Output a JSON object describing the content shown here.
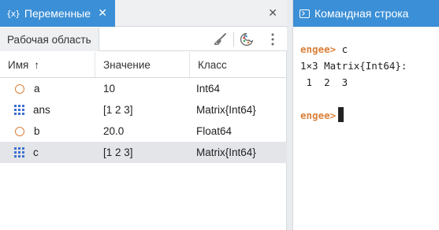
{
  "variables_panel": {
    "tab_icon": "{x}",
    "tab_title": "Переменные",
    "tab_close": "✕",
    "panel_close": "✕",
    "workspace_tab": "Рабочая область",
    "toolbar_icons": [
      "broom-icon",
      "palette-icon",
      "more-vertical-icon"
    ],
    "columns": {
      "name": "Имя",
      "sort_arrow": "↑",
      "value": "Значение",
      "class": "Класс"
    },
    "rows": [
      {
        "icon": "scalar-icon",
        "name": "a",
        "value": "10",
        "class": "Int64",
        "selected": false
      },
      {
        "icon": "matrix-icon",
        "name": "ans",
        "value": "[1 2 3]",
        "class": "Matrix{Int64}",
        "selected": false
      },
      {
        "icon": "scalar-icon",
        "name": "b",
        "value": "20.0",
        "class": "Float64",
        "selected": false
      },
      {
        "icon": "matrix-icon",
        "name": "c",
        "value": "[1 2 3]",
        "class": "Matrix{Int64}",
        "selected": true
      }
    ]
  },
  "command_panel": {
    "tab_title": "Командная строка",
    "lines": {
      "prompt1": "engee>",
      "cmd1": " c",
      "out1": "1×3 Matrix{Int64}:",
      "out2": " 1  2  3",
      "prompt2": "engee>"
    }
  },
  "colors": {
    "accent": "#3b8fd6",
    "prompt": "#d9803a",
    "matrix_icon": "#3b6fd0",
    "selected_row": "#e3e5e8"
  }
}
